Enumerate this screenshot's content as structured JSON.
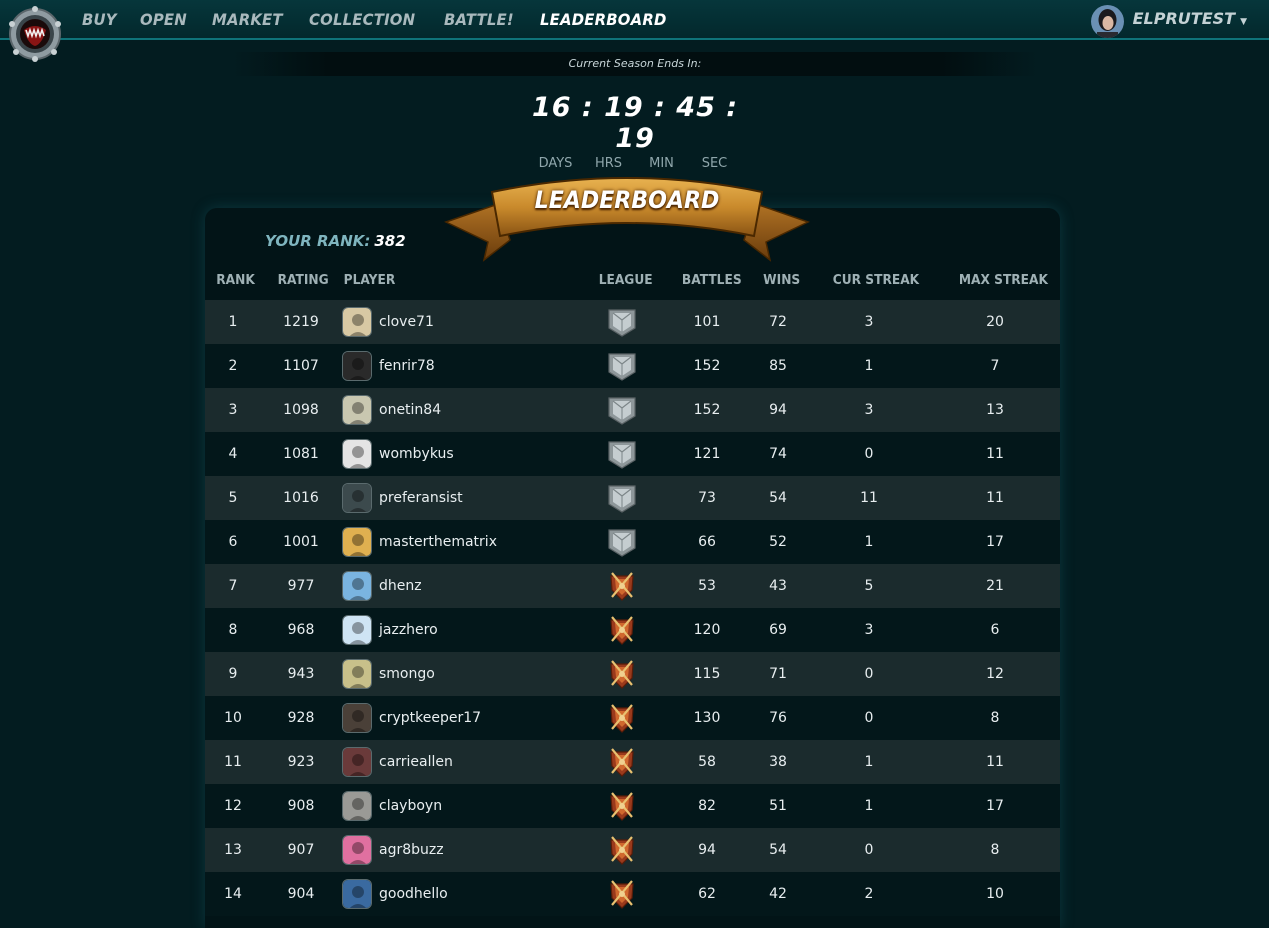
{
  "nav": {
    "items": [
      "BUY",
      "OPEN",
      "MARKET",
      "COLLECTION",
      "BATTLE!",
      "LEADERBOARD"
    ],
    "active": "LEADERBOARD",
    "username": "ELPRUTEST"
  },
  "season": {
    "label": "Current Season Ends In:",
    "countdown": "16 : 19 : 45 : 19",
    "units": [
      "DAYS",
      "HRS",
      "MIN",
      "SEC"
    ]
  },
  "banner": {
    "title": "LEADERBOARD"
  },
  "your_rank": {
    "label": "YOUR RANK:",
    "value": "382"
  },
  "table": {
    "headers": {
      "rank": "RANK",
      "rating": "RATING",
      "player": "PLAYER",
      "league": "LEAGUE",
      "battles": "BATTLES",
      "wins": "WINS",
      "cur_streak": "CUR STREAK",
      "max_streak": "MAX STREAK"
    },
    "rows": [
      {
        "rank": "1",
        "rating": "1219",
        "player": "clove71",
        "league": "silver",
        "battles": "101",
        "wins": "72",
        "cur": "3",
        "max": "20"
      },
      {
        "rank": "2",
        "rating": "1107",
        "player": "fenrir78",
        "league": "silver",
        "battles": "152",
        "wins": "85",
        "cur": "1",
        "max": "7"
      },
      {
        "rank": "3",
        "rating": "1098",
        "player": "onetin84",
        "league": "silver",
        "battles": "152",
        "wins": "94",
        "cur": "3",
        "max": "13"
      },
      {
        "rank": "4",
        "rating": "1081",
        "player": "wombykus",
        "league": "silver",
        "battles": "121",
        "wins": "74",
        "cur": "0",
        "max": "11"
      },
      {
        "rank": "5",
        "rating": "1016",
        "player": "preferansist",
        "league": "silver",
        "battles": "73",
        "wins": "54",
        "cur": "11",
        "max": "11"
      },
      {
        "rank": "6",
        "rating": "1001",
        "player": "masterthematrix",
        "league": "silver",
        "battles": "66",
        "wins": "52",
        "cur": "1",
        "max": "17"
      },
      {
        "rank": "7",
        "rating": "977",
        "player": "dhenz",
        "league": "bronze",
        "battles": "53",
        "wins": "43",
        "cur": "5",
        "max": "21"
      },
      {
        "rank": "8",
        "rating": "968",
        "player": "jazzhero",
        "league": "bronze",
        "battles": "120",
        "wins": "69",
        "cur": "3",
        "max": "6"
      },
      {
        "rank": "9",
        "rating": "943",
        "player": "smongo",
        "league": "bronze",
        "battles": "115",
        "wins": "71",
        "cur": "0",
        "max": "12"
      },
      {
        "rank": "10",
        "rating": "928",
        "player": "cryptkeeper17",
        "league": "bronze",
        "battles": "130",
        "wins": "76",
        "cur": "0",
        "max": "8"
      },
      {
        "rank": "11",
        "rating": "923",
        "player": "carrieallen",
        "league": "bronze",
        "battles": "58",
        "wins": "38",
        "cur": "1",
        "max": "11"
      },
      {
        "rank": "12",
        "rating": "908",
        "player": "clayboyn",
        "league": "bronze",
        "battles": "82",
        "wins": "51",
        "cur": "1",
        "max": "17"
      },
      {
        "rank": "13",
        "rating": "907",
        "player": "agr8buzz",
        "league": "bronze",
        "battles": "94",
        "wins": "54",
        "cur": "0",
        "max": "8"
      },
      {
        "rank": "14",
        "rating": "904",
        "player": "goodhello",
        "league": "bronze",
        "battles": "62",
        "wins": "42",
        "cur": "2",
        "max": "10"
      }
    ]
  },
  "colors": {
    "background": "#031c20",
    "nav_active": "#ffffff",
    "nav_inactive": "#a9b9bd",
    "rank_label": "#7fb5bf",
    "silver_league": "#b9c1c4",
    "bronze_league": "#c0502a",
    "banner_gold": "#c98a2c"
  },
  "avatar_colors": [
    "#d8c9a4",
    "#2a2a2a",
    "#c9c7b0",
    "#e4e4e4",
    "#3c4a4d",
    "#e0b050",
    "#7ab4e0",
    "#cfe4f4",
    "#c8c08a",
    "#4a4038",
    "#6a3a3a",
    "#9a9a96",
    "#e070a0",
    "#3a6aa0"
  ]
}
